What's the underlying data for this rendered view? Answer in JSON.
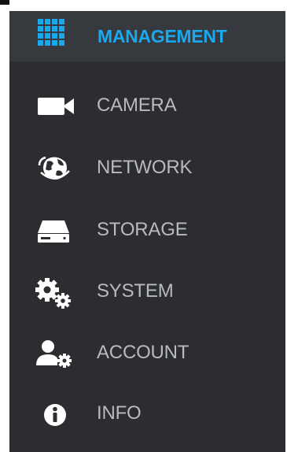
{
  "menu": {
    "header": {
      "label": "MANAGEMENT",
      "icon": "grid-icon",
      "accent_color": "#19a9ee"
    },
    "items": [
      {
        "label": "CAMERA",
        "icon": "camera-icon"
      },
      {
        "label": "NETWORK",
        "icon": "network-globe-icon"
      },
      {
        "label": "STORAGE",
        "icon": "storage-drive-icon"
      },
      {
        "label": "SYSTEM",
        "icon": "gears-icon"
      },
      {
        "label": "ACCOUNT",
        "icon": "account-settings-icon"
      },
      {
        "label": "INFO",
        "icon": "info-icon"
      }
    ],
    "background_color": "#2b2d30",
    "text_color": "#b8babd"
  }
}
